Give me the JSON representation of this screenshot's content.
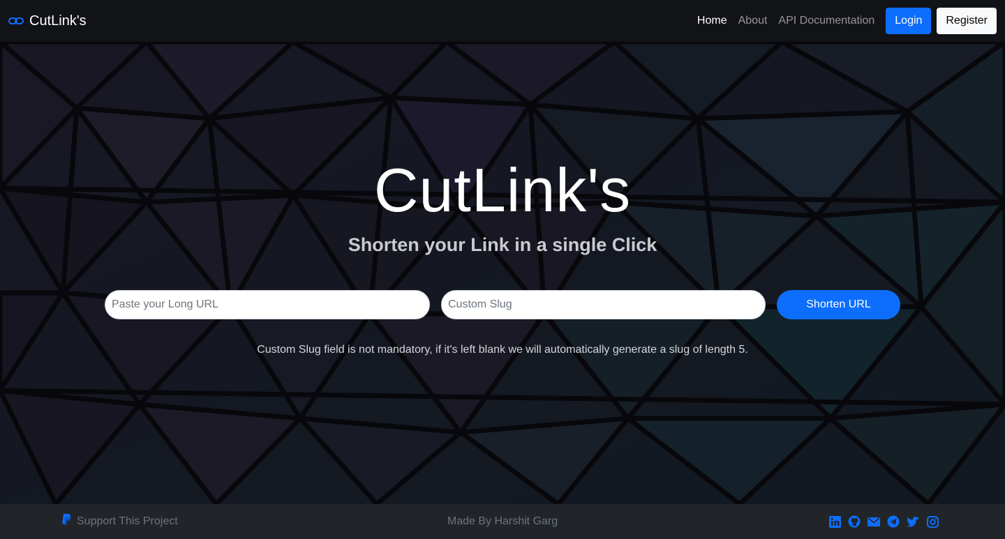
{
  "navbar": {
    "brand": "CutLink's",
    "brand_icon": "link-icon",
    "links": [
      {
        "label": "Home",
        "active": true
      },
      {
        "label": "About",
        "active": false
      },
      {
        "label": "API Documentation",
        "active": false
      }
    ],
    "login_label": "Login",
    "register_label": "Register"
  },
  "hero": {
    "title": "CutLink's",
    "subtitle": "Shorten your Link in a single Click",
    "url_input": {
      "value": "",
      "placeholder": "Paste your Long URL"
    },
    "slug_input": {
      "value": "",
      "placeholder": "Custom Slug"
    },
    "shorten_label": "Shorten URL",
    "hint": "Custom Slug field is not mandatory, if it's left blank we will automatically generate a slug of length 5."
  },
  "footer": {
    "support_label": "Support This Project",
    "support_icon": "paypal-icon",
    "made_by": "Made By Harshit Garg",
    "social_icons": [
      "linkedin-icon",
      "github-icon",
      "mail-icon",
      "telegram-icon",
      "twitter-icon",
      "instagram-icon"
    ]
  },
  "colors": {
    "primary": "#0d6efd",
    "navbar_bg": "#121316",
    "footer_bg": "#212529",
    "muted": "#6c757d"
  }
}
